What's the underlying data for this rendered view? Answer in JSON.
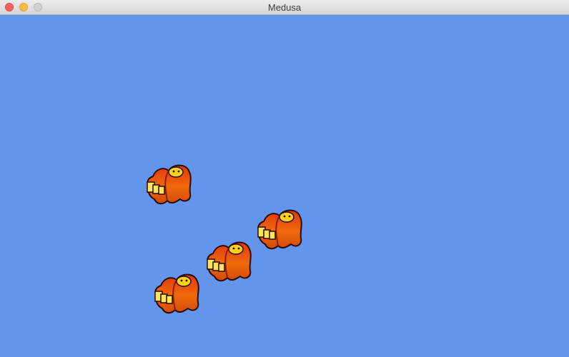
{
  "window": {
    "title": "Medusa",
    "controls": [
      "close",
      "minimize",
      "zoom"
    ]
  },
  "scene": {
    "background": "#6495ed",
    "sprites": [
      {
        "name": "medusa-sprite-1",
        "icon": "orange-cloak-creature-with-cards"
      },
      {
        "name": "medusa-sprite-2",
        "icon": "orange-cloak-creature-with-cards"
      },
      {
        "name": "medusa-sprite-3",
        "icon": "orange-cloak-creature-with-cards"
      },
      {
        "name": "medusa-sprite-4",
        "icon": "orange-cloak-creature-with-cards"
      }
    ]
  }
}
